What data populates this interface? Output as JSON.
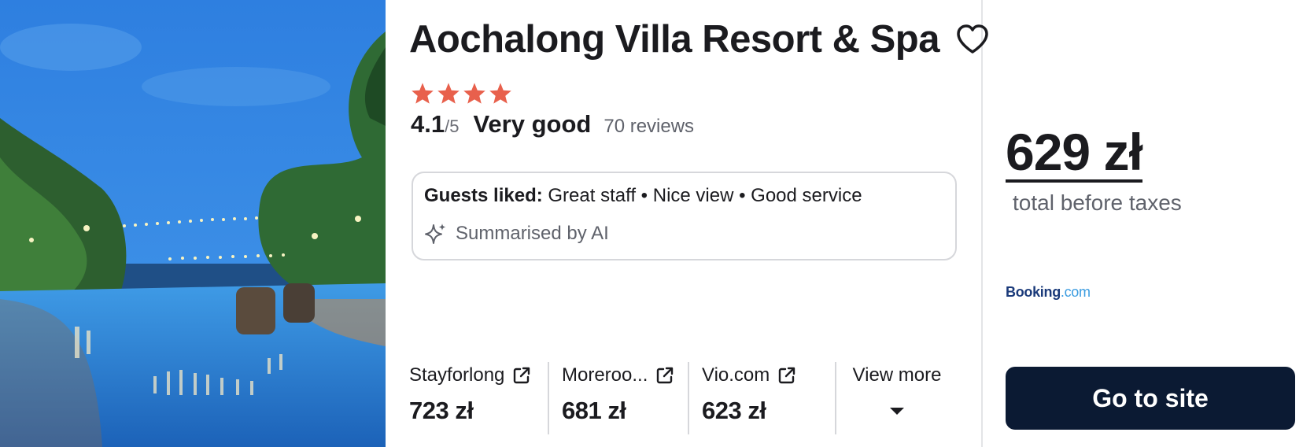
{
  "photo": {
    "alt": "Hotel pool at dusk"
  },
  "hotel": {
    "name": "Aochalong Villa Resort & Spa",
    "stars": 4,
    "star_color": "#e8604c",
    "score": "4.1",
    "score_max": "/5",
    "rating_text": "Very good",
    "reviews": "70 reviews"
  },
  "summary": {
    "liked_label": "Guests liked:",
    "liked_text": "Great staff • Nice view • Good service",
    "ai_label": "Summarised by AI"
  },
  "providers": [
    {
      "name": "Stayforlong",
      "price": "723 zł",
      "icon": "external-link-icon"
    },
    {
      "name": "Moreroo...",
      "price": "681 zł",
      "icon": "external-link-icon"
    },
    {
      "name": "Vio.com",
      "price": "623 zł",
      "icon": "external-link-icon"
    }
  ],
  "view_more": {
    "label": "View more",
    "icon": "caret-down-icon"
  },
  "price_panel": {
    "total": "629 zł",
    "note": "total before taxes",
    "provider_logo_a": "Booking",
    "provider_logo_b": ".com",
    "cta": "Go to site",
    "cta_color": "#0b1a33"
  }
}
